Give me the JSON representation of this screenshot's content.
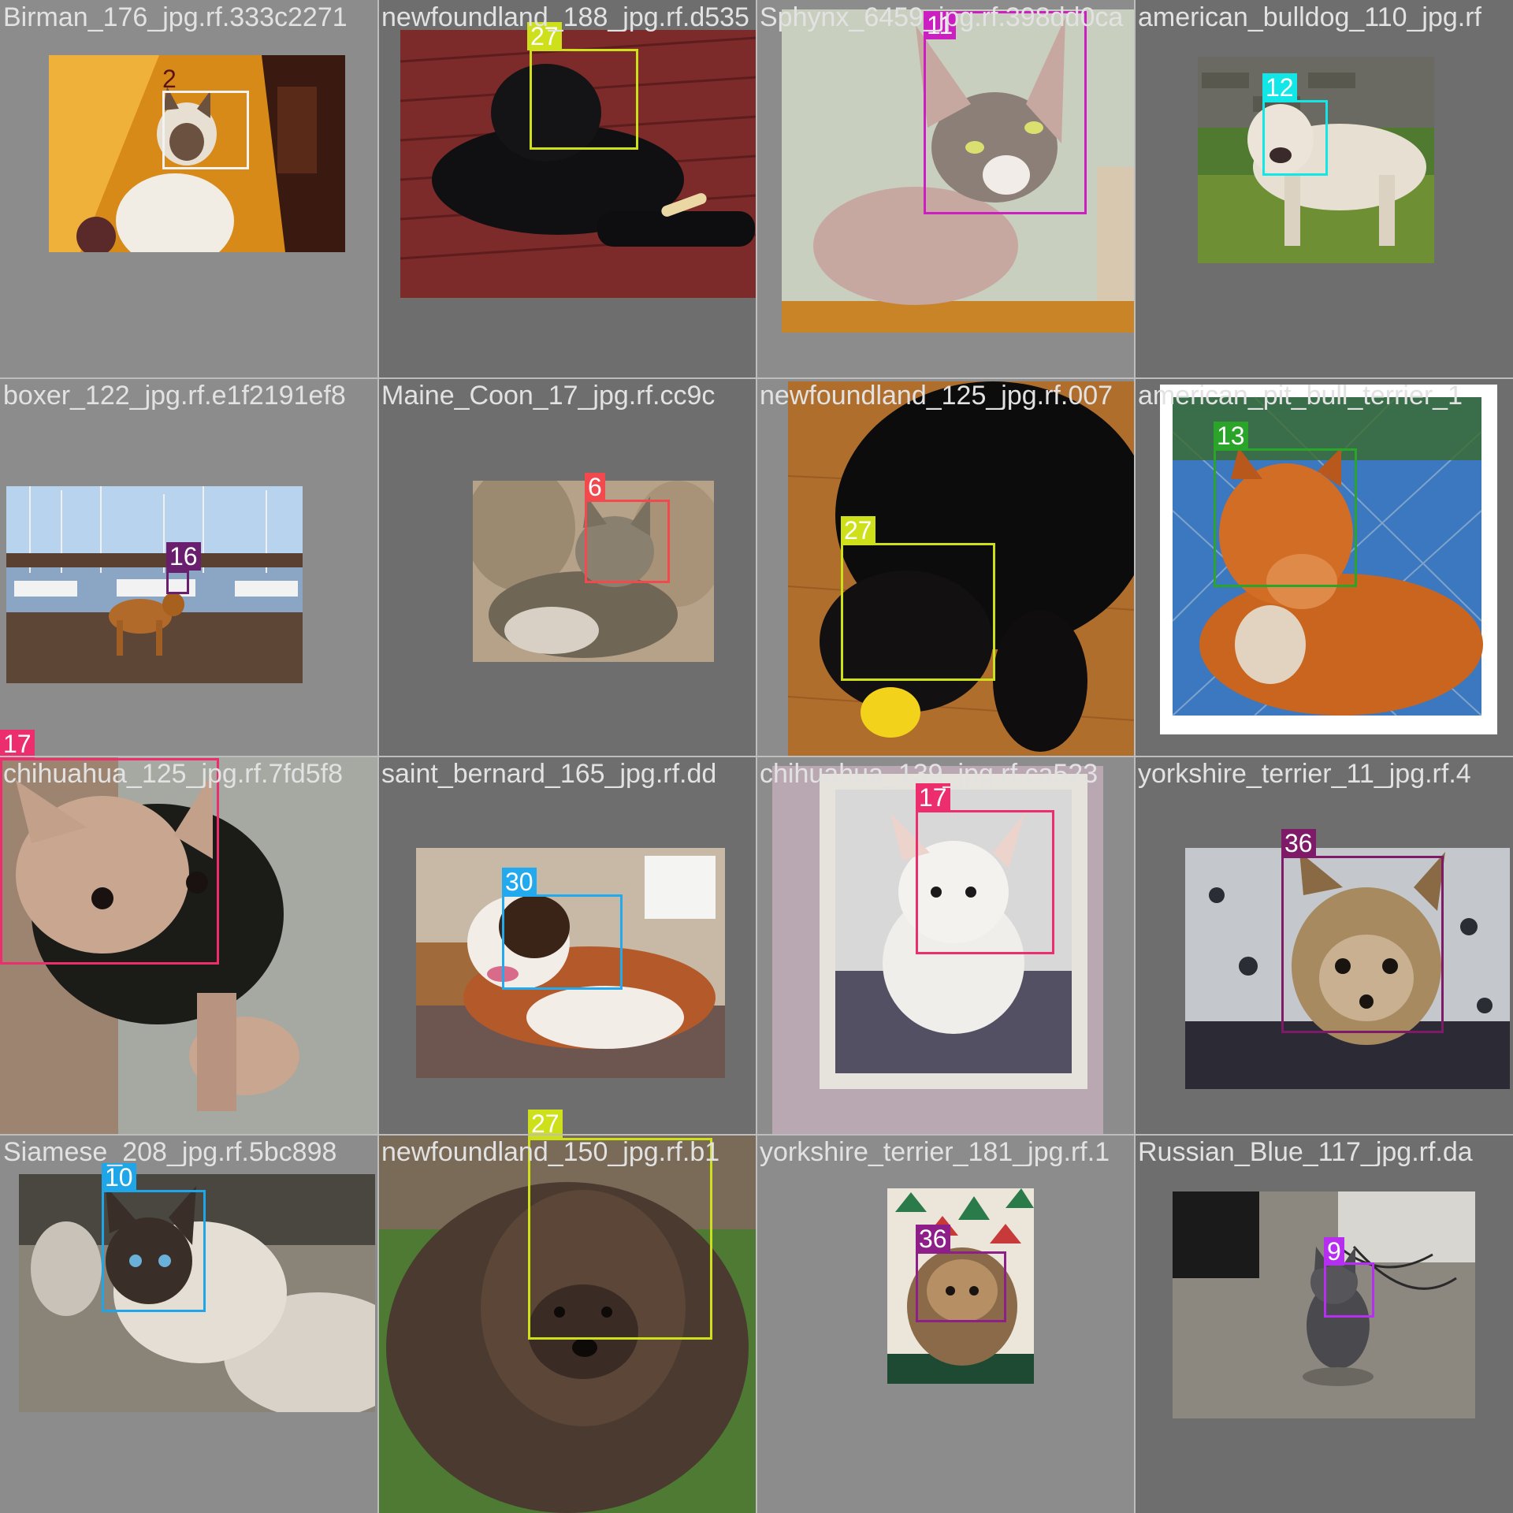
{
  "cells": [
    {
      "filename": "Birman_176_jpg.rf.333c2271",
      "labels": [
        {
          "id": "2",
          "color": "#f2f2f2",
          "text_color": "#5a1414"
        }
      ]
    },
    {
      "filename": "newfoundland_188_jpg.rf.d535",
      "labels": [
        {
          "id": "27",
          "color": "#cde01a",
          "text_color": "#ffffff"
        }
      ]
    },
    {
      "filename": "Sphynx_6459_jpg.rf.398dd0ca",
      "labels": [
        {
          "id": "11",
          "color": "#cc1fc2",
          "text_color": "#ffffff"
        }
      ]
    },
    {
      "filename": "american_bulldog_110_jpg.rf",
      "labels": [
        {
          "id": "12",
          "color": "#13e6e6",
          "text_color": "#ffffff"
        }
      ]
    },
    {
      "filename": "boxer_122_jpg.rf.e1f2191ef8",
      "labels": [
        {
          "id": "16",
          "color": "#6a1e6e",
          "text_color": "#ffffff"
        }
      ]
    },
    {
      "filename": "Maine_Coon_17_jpg.rf.cc9c",
      "labels": [
        {
          "id": "6",
          "color": "#f2494f",
          "text_color": "#ffffff"
        }
      ]
    },
    {
      "filename": "newfoundland_125_jpg.rf.007",
      "labels": [
        {
          "id": "27",
          "color": "#cde01a",
          "text_color": "#ffffff"
        }
      ]
    },
    {
      "filename": "american_pit_bull_terrier_1",
      "labels": [
        {
          "id": "13",
          "color": "#2aa52a",
          "text_color": "#ffffff"
        }
      ]
    },
    {
      "filename": "chihuahua_125_jpg.rf.7fd5f8",
      "labels": [
        {
          "id": "17",
          "color": "#ec2d6e",
          "text_color": "#ffffff"
        }
      ]
    },
    {
      "filename": "saint_bernard_165_jpg.rf.dd",
      "labels": [
        {
          "id": "30",
          "color": "#22a9ee",
          "text_color": "#ffffff"
        }
      ]
    },
    {
      "filename": "chihuahua_139_jpg.rf.ca523",
      "labels": [
        {
          "id": "17",
          "color": "#ec2d6e",
          "text_color": "#ffffff"
        }
      ]
    },
    {
      "filename": "yorkshire_terrier_11_jpg.rf.4",
      "labels": [
        {
          "id": "36",
          "color": "#7e1a68",
          "text_color": "#ffffff"
        }
      ]
    },
    {
      "filename": "Siamese_208_jpg.rf.5bc898",
      "labels": [
        {
          "id": "10",
          "color": "#1fa6e8",
          "text_color": "#ffffff"
        }
      ]
    },
    {
      "filename": "newfoundland_150_jpg.rf.b1",
      "labels": [
        {
          "id": "27",
          "color": "#cde01a",
          "text_color": "#ffffff"
        }
      ]
    },
    {
      "filename": "yorkshire_terrier_181_jpg.rf.1",
      "labels": [
        {
          "id": "36",
          "color": "#8e1e88",
          "text_color": "#ffffff"
        }
      ]
    },
    {
      "filename": "Russian_Blue_117_jpg.rf.da",
      "labels": [
        {
          "id": "9",
          "color": "#b62ff0",
          "text_color": "#ffffff"
        }
      ]
    }
  ]
}
